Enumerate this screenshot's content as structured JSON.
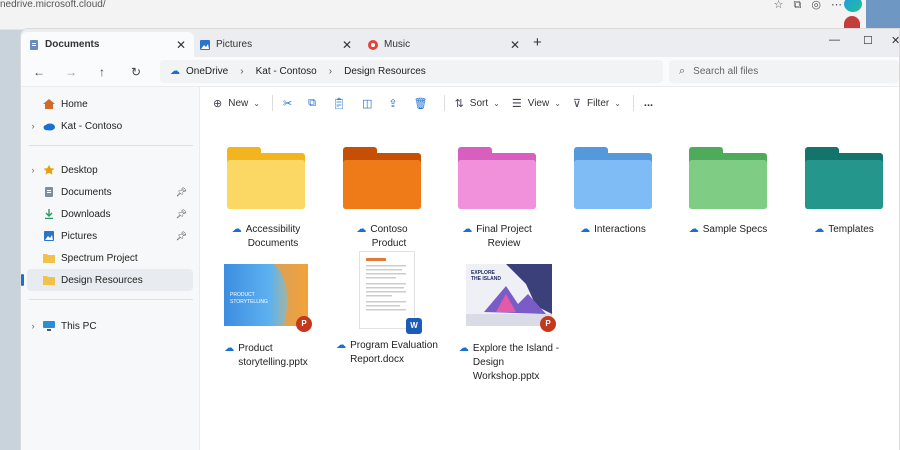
{
  "browser": {
    "url": "nedrive.microsoft.cloud/",
    "icons": [
      "star-icon",
      "collections-icon",
      "browser-extensions-icon",
      "more-icon"
    ]
  },
  "tabs": [
    {
      "label": "Documents",
      "icon": "documents-icon",
      "color": "#4a6fa5",
      "active": true
    },
    {
      "label": "Pictures",
      "icon": "pictures-icon",
      "color": "#2a74c9",
      "active": false
    },
    {
      "label": "Music",
      "icon": "music-icon",
      "color": "#e0453a",
      "active": false
    }
  ],
  "address": {
    "crumbs": [
      "OneDrive",
      "Kat - Contoso",
      "Design Resources"
    ]
  },
  "search": {
    "placeholder": "Search all files"
  },
  "sidebar": {
    "items": [
      {
        "label": "Home",
        "icon": "home-icon",
        "chevron": false
      },
      {
        "label": "Kat - Contoso",
        "icon": "onedrive-cloud-icon",
        "chevron": true
      },
      {
        "label": "Desktop",
        "icon": "desktop-icon",
        "chevron": true
      },
      {
        "label": "Documents",
        "icon": "documents-icon",
        "pinned": true
      },
      {
        "label": "Downloads",
        "icon": "downloads-icon",
        "pinned": true
      },
      {
        "label": "Pictures",
        "icon": "pictures-icon",
        "pinned": true
      },
      {
        "label": "Spectrum Project",
        "icon": "folder-icon"
      },
      {
        "label": "Design Resources",
        "icon": "folder-icon",
        "selected": true
      },
      {
        "label": "This PC",
        "icon": "this-pc-icon",
        "chevron": true
      }
    ]
  },
  "commands": {
    "new": "New",
    "sort": "Sort",
    "view": "View",
    "filter": "Filter",
    "more": "..."
  },
  "items": [
    {
      "name": "Accessibility Documents",
      "line1": "Accessibility",
      "line2": "Documents",
      "type": "folder",
      "color": "#f7c94a",
      "color_front": "#fbd764"
    },
    {
      "name": "Contoso Product",
      "line1": "Contoso",
      "line2": "Product",
      "type": "folder",
      "color": "#d95b0a",
      "color_front": "#ee7a18"
    },
    {
      "name": "Final Project Review",
      "line1": "Final Project",
      "line2": "Review",
      "type": "folder",
      "color": "#de6fc6",
      "color_front": "#f191dc"
    },
    {
      "name": "Interactions",
      "line1": "Interactions",
      "line2": "",
      "type": "folder",
      "color": "#5fa4e8",
      "color_front": "#7fbcf5"
    },
    {
      "name": "Sample Specs",
      "line1": "Sample Specs",
      "line2": "",
      "type": "folder",
      "color": "#5fb56a",
      "color_front": "#7fcd84"
    },
    {
      "name": "Templates",
      "line1": "Templates",
      "line2": "",
      "type": "folder",
      "color": "#1a7f76",
      "color_front": "#24968c"
    },
    {
      "name": "Product storytelling.pptx",
      "line1": "Product",
      "line2": "storytelling.pptx",
      "type": "pptx",
      "thumb_text": "PRODUCT STORYTELLING"
    },
    {
      "name": "Program Evaluation Report.docx",
      "line1": "Program Evaluation",
      "line2": "Report.docx",
      "type": "docx"
    },
    {
      "name": "Explore the Island - Design Workshop.pptx",
      "line1": "Explore the Island -",
      "line2": "Design",
      "line3": "Workshop.pptx",
      "type": "pptx",
      "thumb_text": "EXPLORE THE ISLAND"
    }
  ]
}
